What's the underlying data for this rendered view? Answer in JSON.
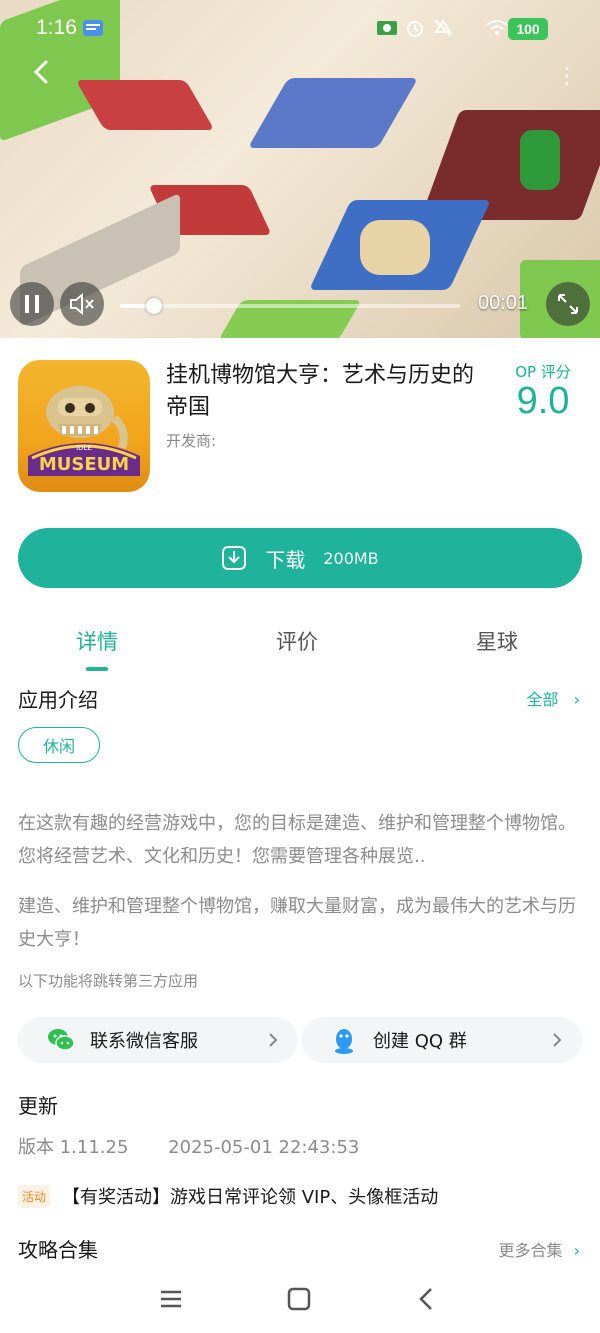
{
  "status_bar": {
    "time": "1:16",
    "battery": "100",
    "icons": [
      "message-icon",
      "money-icon",
      "alarm-icon",
      "mute-icon",
      "wifi-icon"
    ]
  },
  "video": {
    "elapsed": "00:01",
    "progress_fraction": 0.1,
    "controls": [
      "pause-icon",
      "volume-mute-icon",
      "fullscreen-icon"
    ]
  },
  "app": {
    "title": "挂机博物馆大亨：艺术与历史的帝国",
    "developer_label": "开发商:",
    "score_label": "OP 评分",
    "score_value": "9.0",
    "icon_text": {
      "idle": "IDLE",
      "museum": "MUSEUM"
    }
  },
  "download": {
    "label": "下载",
    "size": "200MB"
  },
  "tabs": [
    {
      "label": "详情",
      "active": true
    },
    {
      "label": "评价",
      "active": false
    },
    {
      "label": "星球",
      "active": false
    }
  ],
  "intro": {
    "title": "应用介绍",
    "all_link": "全部",
    "tag": "休闲",
    "para1": "在这款有趣的经营游戏中，您的目标是建造、维护和管理整个博物馆。您将经营艺术、文化和历史！您需要管理各种展览..",
    "para2": "建造、维护和管理整个博物馆，赚取大量财富，成为最伟大的艺术与历史大亨！",
    "third_party_note": "以下功能将跳转第三方应用"
  },
  "social": {
    "wechat_label": "联系微信客服",
    "qq_label": "创建 QQ 群"
  },
  "update": {
    "title": "更新",
    "version": "版本 1.11.25",
    "date": "2025-05-01 22:43:53",
    "activity_badge": "活动",
    "activity_text": "【有奖活动】游戏日常评论领 VIP、头像框活动"
  },
  "guides": {
    "title": "攻略合集",
    "more_link": "更多合集"
  },
  "colors": {
    "accent": "#1fb39b",
    "activity": "#f08a26"
  }
}
